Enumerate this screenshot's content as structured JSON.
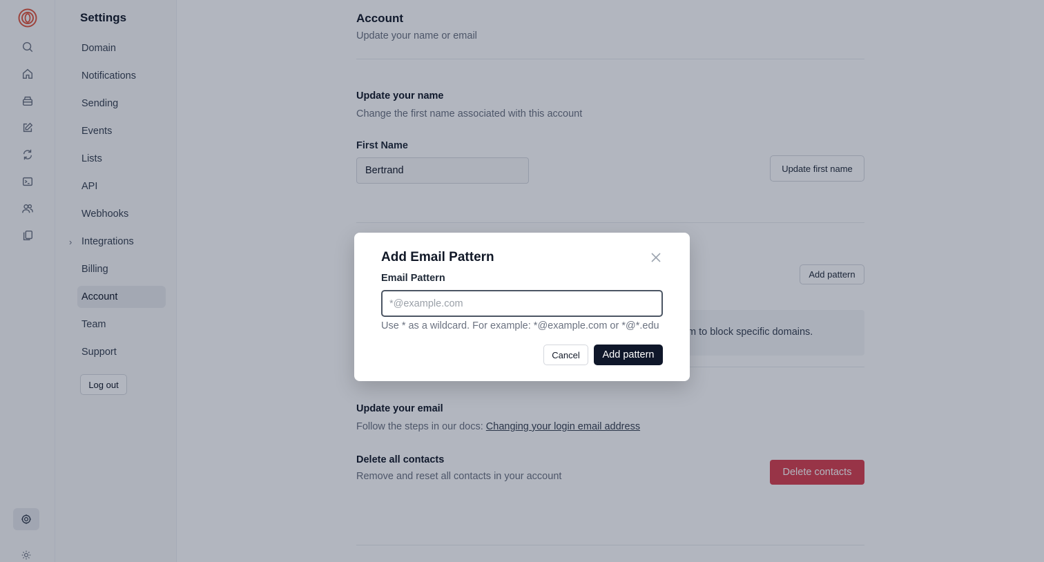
{
  "sidebar": {
    "title": "Settings",
    "items": [
      {
        "label": "Domain",
        "active": false
      },
      {
        "label": "Notifications",
        "active": false
      },
      {
        "label": "Sending",
        "active": false
      },
      {
        "label": "Events",
        "active": false
      },
      {
        "label": "Lists",
        "active": false
      },
      {
        "label": "API",
        "active": false
      },
      {
        "label": "Webhooks",
        "active": false
      },
      {
        "label": "Integrations",
        "active": false,
        "expandable": true
      },
      {
        "label": "Billing",
        "active": false
      },
      {
        "label": "Account",
        "active": true
      },
      {
        "label": "Team",
        "active": false
      },
      {
        "label": "Support",
        "active": false
      }
    ],
    "logout_label": "Log out"
  },
  "rail": {
    "icons": [
      "logo-icon",
      "search-icon",
      "home-icon",
      "inbox-icon",
      "edit-icon",
      "refresh-icon",
      "terminal-icon",
      "users-icon",
      "copy-icon",
      "settings-icon",
      "sun-icon"
    ]
  },
  "account": {
    "title": "Account",
    "subtitle": "Update your name or email",
    "name_section": {
      "title": "Update your name",
      "description": "Change the first name associated with this account",
      "field_label": "First Name",
      "field_value": "Bertrand",
      "button_label": "Update first name"
    },
    "pattern_section": {
      "button_label": "Add pattern",
      "info_text_visible": "m to block specific domains."
    },
    "email_section": {
      "title": "Update your email",
      "description": "Follow the steps in our docs:",
      "link_text": "Changing your login email address"
    },
    "delete_section": {
      "title": "Delete all contacts",
      "description": "Remove and reset all contacts in your account",
      "button_label": "Delete contacts"
    }
  },
  "modal": {
    "title": "Add Email Pattern",
    "field_label": "Email Pattern",
    "placeholder": "*@example.com",
    "value": "",
    "hint": "Use * as a wildcard. For example: *@example.com or *@*.edu",
    "cancel_label": "Cancel",
    "submit_label": "Add pattern"
  },
  "colors": {
    "danger": "#d9404f",
    "primary": "#0f172a",
    "logo": "#e0563f"
  }
}
